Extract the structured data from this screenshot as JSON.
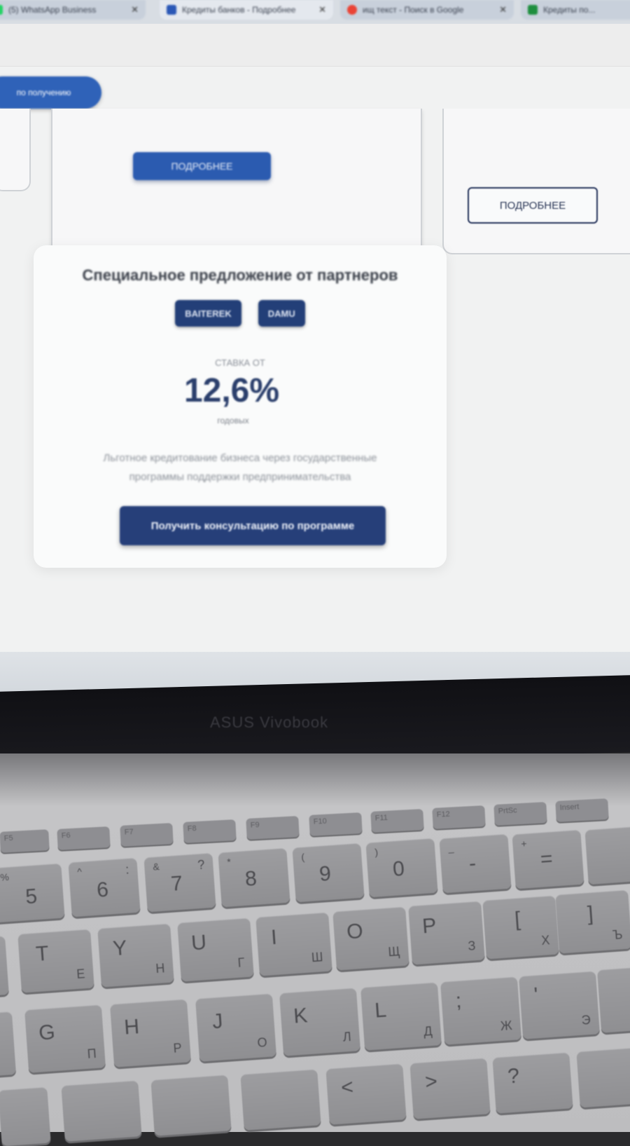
{
  "browser": {
    "tabs": [
      {
        "label": "(5) WhatsApp Business",
        "favicon_color": "#25d366"
      },
      {
        "label": "Кредиты банков - Подробнее",
        "favicon_color": "#2a57b6"
      },
      {
        "label": "ищ текст - Поиск в Google",
        "favicon_color": "#ea4335"
      },
      {
        "label": "Кредиты по...",
        "favicon_color": "#1e8e3e"
      }
    ],
    "close_glyph": "✕"
  },
  "page": {
    "pill_label": "по получению",
    "cards_top": {
      "mid_button": "ПОДРОБНЕЕ",
      "right_button": "ПОДРОБНЕЕ"
    },
    "offer": {
      "title": "Специальное предложение от партнеров",
      "partners": [
        "BAITEREK",
        "DAMU"
      ],
      "rate_label": "СТАВКА ОТ",
      "rate_value": "12,6%",
      "rate_period": "годовых",
      "description": "Льготное кредитование бизнеса через государственные программы поддержки предпринимательства",
      "cta": "Получить консультацию по программе"
    }
  },
  "laptop": {
    "brand": "ASUS Vivobook",
    "fn_keys": [
      "F5",
      "F6",
      "F7",
      "F8",
      "F9",
      "F10",
      "F11",
      "F12",
      "PrtSc",
      "Insert"
    ],
    "keys": {
      "row_digits": [
        {
          "main": "5",
          "top": "%"
        },
        {
          "main": "6",
          "top": "^",
          "sub": ":"
        },
        {
          "main": "7",
          "top": "&",
          "sub": "?"
        },
        {
          "main": "8",
          "top": "*"
        },
        {
          "main": "9",
          "top": "("
        },
        {
          "main": "0",
          "top": ")"
        },
        {
          "main": "-",
          "top": "_"
        },
        {
          "main": "=",
          "top": "+"
        }
      ],
      "row_top": [
        {
          "main": "T",
          "sub": "Е"
        },
        {
          "main": "Y",
          "sub": "Н"
        },
        {
          "main": "U",
          "sub": "Г"
        },
        {
          "main": "I",
          "sub": "Ш"
        },
        {
          "main": "O",
          "sub": "Щ"
        },
        {
          "main": "P",
          "sub": "З"
        },
        {
          "main": "[",
          "sub": "Х"
        },
        {
          "main": "]",
          "sub": "Ъ"
        }
      ],
      "row_home": [
        {
          "main": "G",
          "sub": "П"
        },
        {
          "main": "H",
          "sub": "Р"
        },
        {
          "main": "J",
          "sub": "О"
        },
        {
          "main": "K",
          "sub": "Л"
        },
        {
          "main": "L",
          "sub": "Д"
        },
        {
          "main": ";",
          "sub": "Ж"
        },
        {
          "main": "'",
          "sub": "Э"
        }
      ],
      "row_bottom": [
        {
          "main": "<"
        },
        {
          "main": ">"
        },
        {
          "main": "?"
        }
      ]
    }
  }
}
